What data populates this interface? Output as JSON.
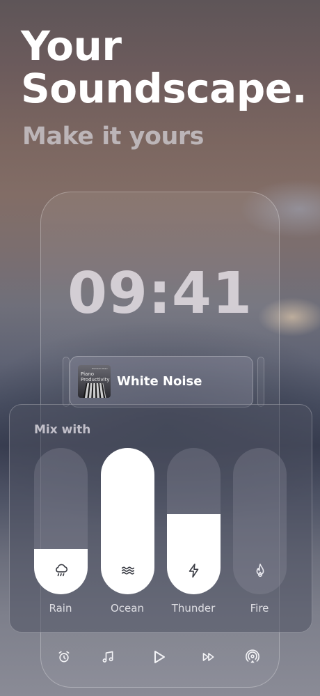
{
  "headline": {
    "line1": "Your",
    "line2": "Soundscape.",
    "subtitle": "Make it yours"
  },
  "lock_screen": {
    "time": "09:41"
  },
  "now_playing": {
    "title": "White Noise",
    "album_art": {
      "brand": "Premium Music",
      "title_line1": "Piano",
      "title_line2": "Productivity"
    }
  },
  "mixer": {
    "label": "Mix with",
    "sliders": [
      {
        "label": "Rain",
        "icon": "rain-cloud-icon",
        "level": 0.31
      },
      {
        "label": "Ocean",
        "icon": "waves-icon",
        "level": 1.0
      },
      {
        "label": "Thunder",
        "icon": "lightning-bolt-icon",
        "level": 0.55
      },
      {
        "label": "Fire",
        "icon": "flame-icon",
        "level": 0.0
      }
    ]
  },
  "toolbar": {
    "items": [
      {
        "icon": "alarm-clock-icon"
      },
      {
        "icon": "music-note-icon"
      },
      {
        "icon": "play-icon"
      },
      {
        "icon": "fast-forward-icon"
      },
      {
        "icon": "airplay-icon"
      }
    ]
  },
  "colors": {
    "slider_fill": "#ffffff",
    "slider_track": "#96969f",
    "text_primary": "#ffffff"
  }
}
